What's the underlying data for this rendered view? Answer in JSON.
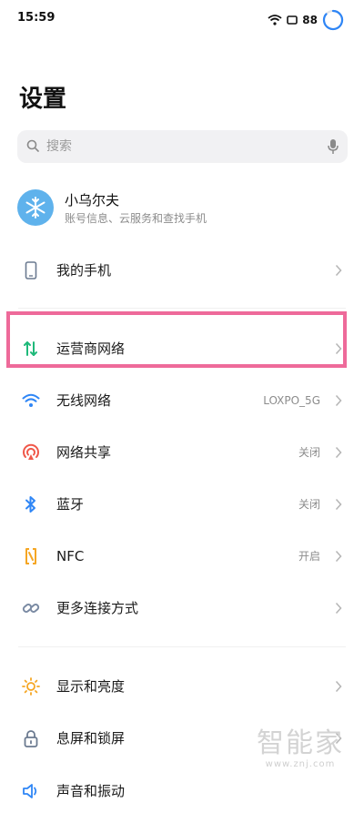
{
  "status_bar": {
    "time": "15:59",
    "battery": "88"
  },
  "page": {
    "title": "设置"
  },
  "search": {
    "placeholder": "搜索"
  },
  "account": {
    "name": "小乌尔夫",
    "subtitle": "账号信息、云服务和查找手机"
  },
  "settings_items": [
    {
      "label": "我的手机",
      "value": "",
      "icon": "phone-icon"
    },
    {
      "label": "运营商网络",
      "value": "",
      "icon": "cellular-data-icon"
    },
    {
      "label": "无线网络",
      "value": "LOXPO_5G",
      "icon": "wifi-icon"
    },
    {
      "label": "网络共享",
      "value": "关闭",
      "icon": "hotspot-icon"
    },
    {
      "label": "蓝牙",
      "value": "关闭",
      "icon": "bluetooth-icon"
    },
    {
      "label": "NFC",
      "value": "开启",
      "icon": "nfc-icon"
    },
    {
      "label": "更多连接方式",
      "value": "",
      "icon": "link-icon"
    },
    {
      "label": "显示和亮度",
      "value": "",
      "icon": "brightness-icon"
    },
    {
      "label": "息屏和锁屏",
      "value": "",
      "icon": "lock-icon"
    },
    {
      "label": "声音和振动",
      "value": "",
      "icon": "sound-icon"
    }
  ],
  "watermark": {
    "text": "智能家",
    "url": "www.znj.com"
  },
  "colors": {
    "highlight": "#ee6a9a",
    "wifi": "#2f86f6",
    "hotspot": "#f0584a",
    "bluetooth": "#2f86f6",
    "nfc": "#f5a623",
    "brightness": "#f5a623",
    "cellular": "#1fb97a",
    "avatar": "#5fb2ec"
  }
}
